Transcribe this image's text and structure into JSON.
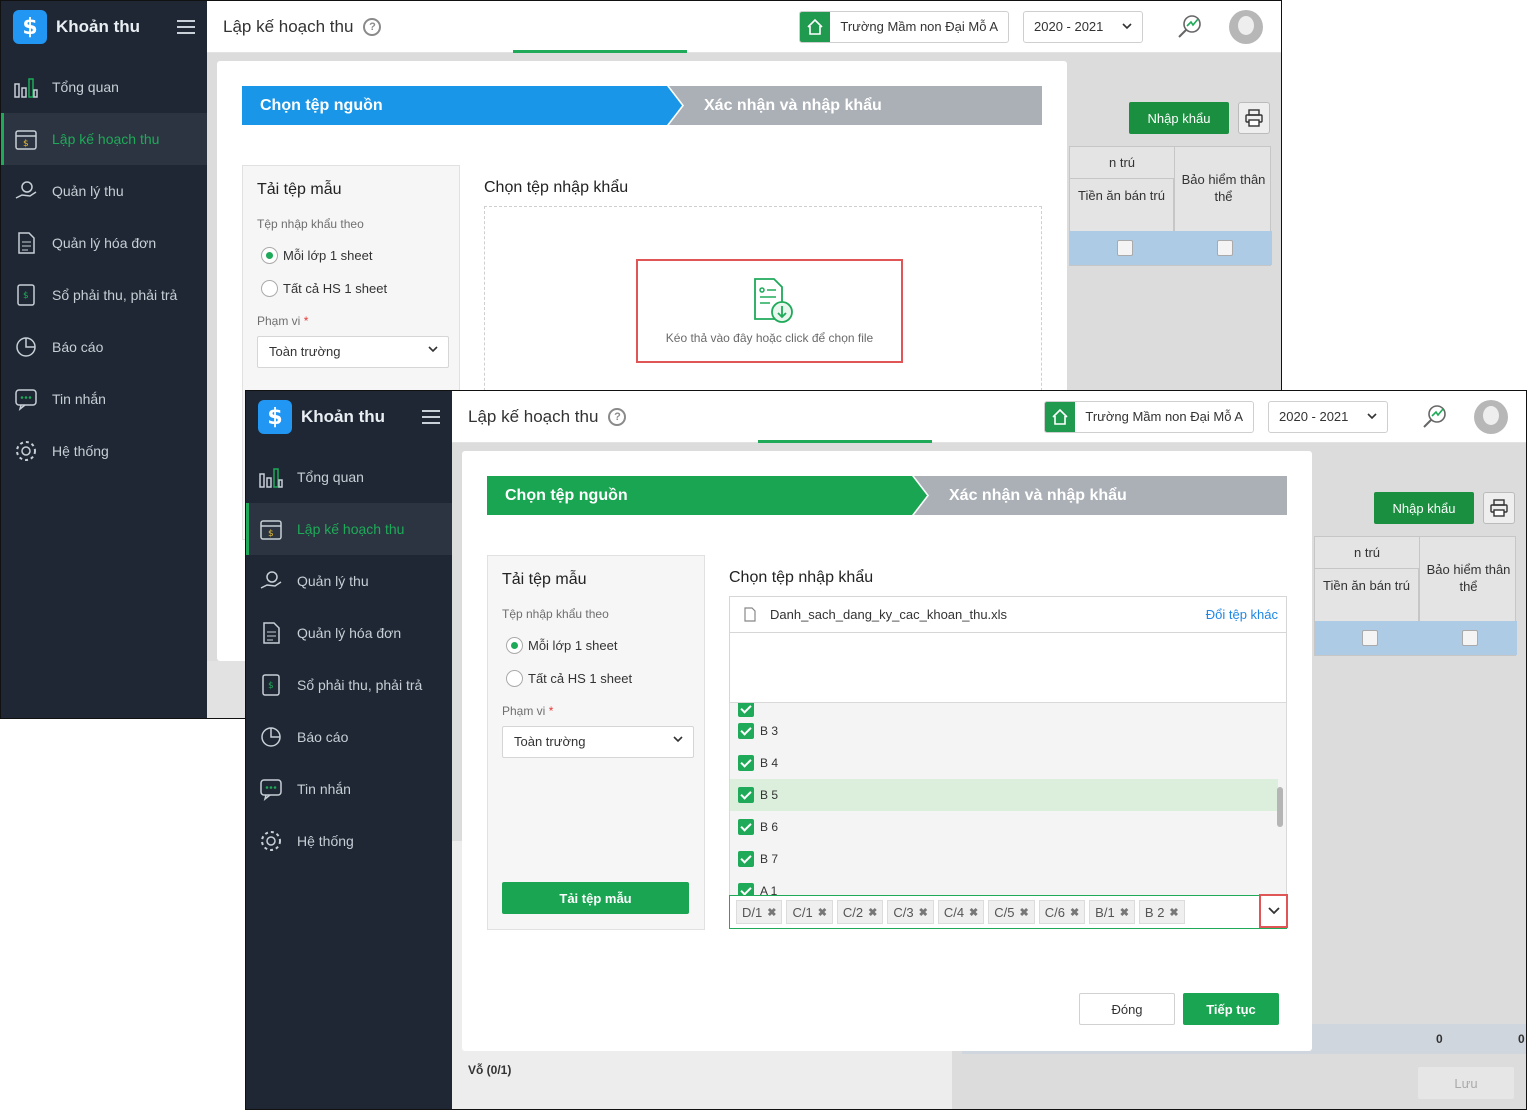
{
  "app": {
    "name": "Khoản thu",
    "page_title": "Lập kế hoạch thu",
    "school": "Trường Mầm non Đại Mỗ A",
    "year": "2020 - 2021"
  },
  "nav": [
    {
      "label": "Tổng quan",
      "icon": "bar-chart-icon"
    },
    {
      "label": "Lập kế hoạch thu",
      "icon": "calendar-dollar-icon",
      "active": true
    },
    {
      "label": "Quản lý thu",
      "icon": "hand-coin-icon"
    },
    {
      "label": "Quản lý hóa đơn",
      "icon": "invoice-icon"
    },
    {
      "label": "Sổ phải thu, phải trả",
      "icon": "ledger-icon"
    },
    {
      "label": "Báo cáo",
      "icon": "pie-chart-icon"
    },
    {
      "label": "Tin nhắn",
      "icon": "chat-icon"
    },
    {
      "label": "Hệ thống",
      "icon": "gear-icon"
    }
  ],
  "background": {
    "import_button": "Nhập khẩu",
    "col_group": "n trú",
    "col_meal": "Tiền ăn bán trú",
    "col_insurance": "Bảo hiểm thân thể",
    "footer_a": "0",
    "footer_b": "0",
    "save_button": "Lưu",
    "partial_row": "Vỗ (0/1)"
  },
  "wizard": {
    "step1": "Chọn tệp nguồn",
    "step2": "Xác nhận và nhập khẩu",
    "step1_color_first": "#1a96e8",
    "step1_color_second": "#1aa552"
  },
  "template_panel": {
    "title": "Tải tệp mẫu",
    "subtitle": "Tệp nhập khẩu theo",
    "option_one": "Mỗi lớp 1 sheet",
    "option_two": "Tất cả HS 1 sheet",
    "scope_label": "Phạm vi",
    "required_mark": "*",
    "scope_value": "Toàn trường",
    "download_button": "Tải tệp mẫu"
  },
  "import_panel": {
    "title": "Chọn tệp nhập khẩu",
    "drop_hint": "Kéo thả vào đây hoặc click để chọn file",
    "file_name": "Danh_sach_dang_ky_cac_khoan_thu.xls",
    "change_file": "Đổi tệp khác",
    "options": [
      "B 3",
      "B 4",
      "B 5",
      "B 6",
      "B 7",
      "A 1"
    ],
    "highlighted_option": "B 5",
    "selected_tags": [
      "D/1",
      "C/1",
      "C/2",
      "C/3",
      "C/4",
      "C/5",
      "C/6",
      "B/1",
      "B 2"
    ]
  },
  "buttons": {
    "close": "Đóng",
    "next": "Tiếp tục"
  }
}
